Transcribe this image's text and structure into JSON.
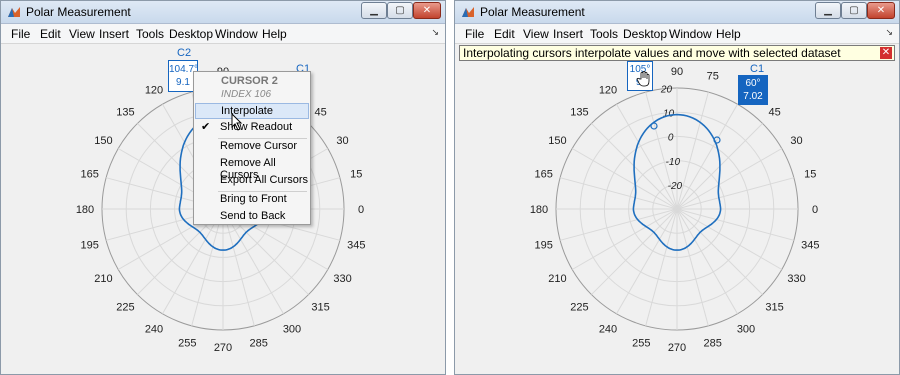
{
  "windows": [
    {
      "title": "Polar Measurement",
      "menu": [
        "File",
        "Edit",
        "View",
        "Insert",
        "Tools",
        "Desktop",
        "Window",
        "Help"
      ]
    },
    {
      "title": "Polar Measurement",
      "menu": [
        "File",
        "Edit",
        "View",
        "Insert",
        "Tools",
        "Desktop",
        "Window",
        "Help"
      ]
    }
  ],
  "angle_ticks": [
    "0",
    "15",
    "30",
    "45",
    "60",
    "75",
    "90",
    "105",
    "120",
    "135",
    "150",
    "165",
    "180",
    "195",
    "210",
    "225",
    "240",
    "255",
    "270",
    "285",
    "300",
    "315",
    "330",
    "345"
  ],
  "radius_ticks": [
    "-20",
    "-10",
    "0",
    "10",
    "20"
  ],
  "left": {
    "cursor2": {
      "name": "C2",
      "angle": "104.7°",
      "value": "9.1"
    },
    "cursor1": {
      "name": "C1"
    },
    "context_menu": {
      "header": "CURSOR 2",
      "subheader": "INDEX 106",
      "items": [
        "Interpolate",
        "Show Readout",
        "Remove Cursor",
        "Remove All Cursors",
        "Export All Cursors",
        "Bring to Front",
        "Send to Back"
      ]
    }
  },
  "right": {
    "info_bar": "Interpolating cursors interpolate values and move with selected dataset",
    "cursor1": {
      "name": "C1",
      "angle": "60°",
      "value": "7.02"
    },
    "cursor2": {
      "angle": "105°",
      "value": "9."
    }
  },
  "colors": {
    "trace": "#1f6fbf",
    "cursor_fill": "#1565c0",
    "grid": "#d9d9d9"
  }
}
